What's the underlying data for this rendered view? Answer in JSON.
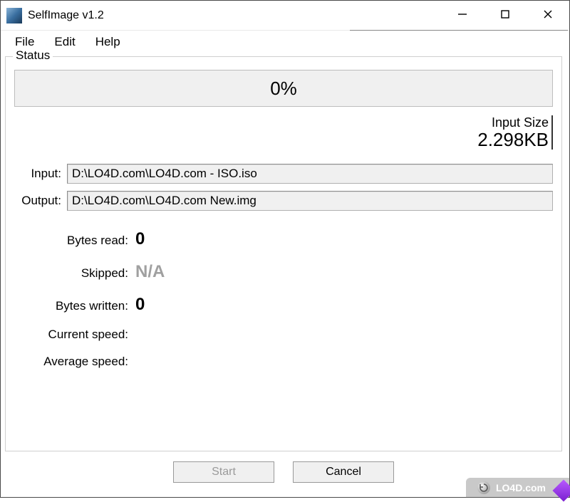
{
  "window": {
    "title": "SelfImage v1.2"
  },
  "menu": {
    "file": "File",
    "edit": "Edit",
    "help": "Help"
  },
  "status": {
    "legend": "Status",
    "progress_text": "0%",
    "input_size_label": "Input Size",
    "input_size_value": "2.298KB",
    "input_label": "Input:",
    "input_path": "D:\\LO4D.com\\LO4D.com - ISO.iso",
    "output_label": "Output:",
    "output_path": "D:\\LO4D.com\\LO4D.com New.img",
    "bytes_read_label": "Bytes read:",
    "bytes_read_value": "0",
    "skipped_label": "Skipped:",
    "skipped_value": "N/A",
    "bytes_written_label": "Bytes written:",
    "bytes_written_value": "0",
    "current_speed_label": "Current speed:",
    "current_speed_value": "",
    "average_speed_label": "Average speed:",
    "average_speed_value": ""
  },
  "buttons": {
    "start": "Start",
    "cancel": "Cancel"
  },
  "watermark": {
    "text": "LO4D.com"
  }
}
